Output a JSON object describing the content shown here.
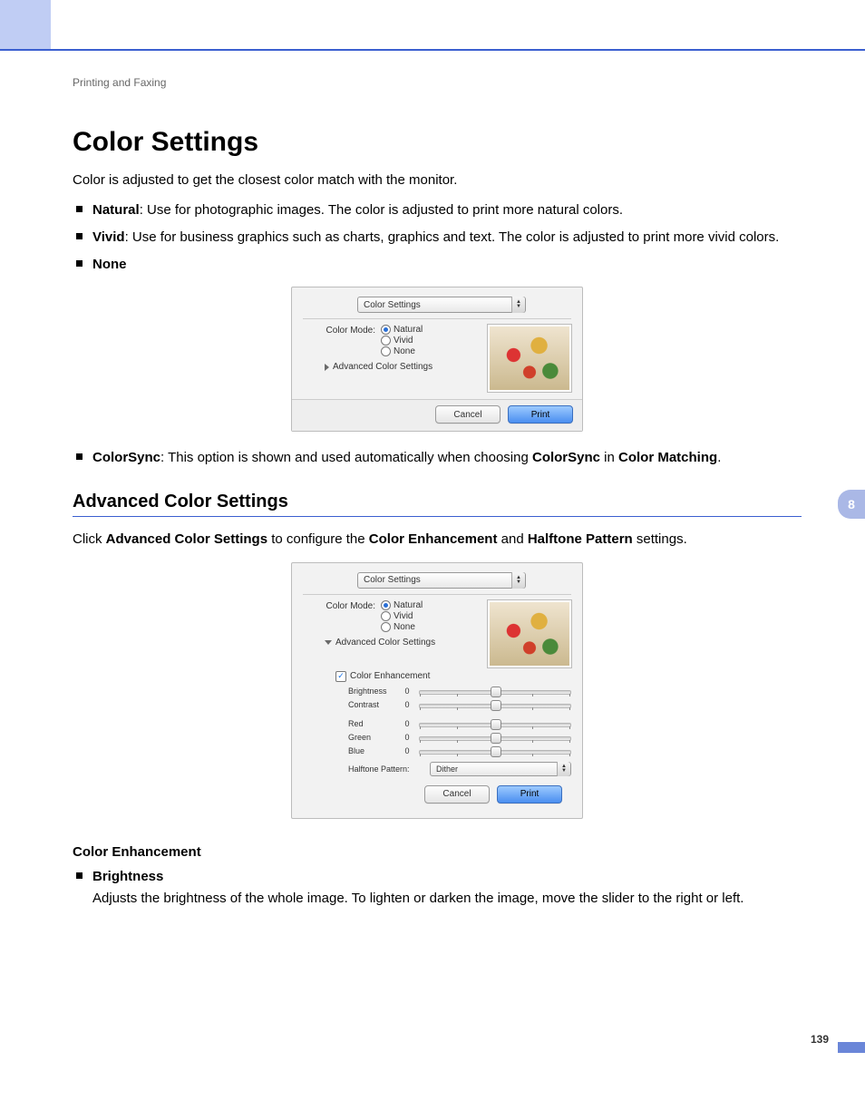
{
  "header": {
    "section": "Printing and Faxing"
  },
  "chapter_tab": "8",
  "page_number": "139",
  "title": "Color Settings",
  "intro": "Color is adjusted to get the closest color match with the monitor.",
  "mode_list": {
    "natural": {
      "label": "Natural",
      "desc": ": Use for photographic images. The color is adjusted to print more natural colors."
    },
    "vivid": {
      "label": "Vivid",
      "desc": ": Use for business graphics such as charts, graphics and text. The color is adjusted to print more vivid colors."
    },
    "none": {
      "label": "None"
    }
  },
  "dialog": {
    "dropdown": "Color Settings",
    "color_mode_label": "Color Mode:",
    "radios": {
      "natural": "Natural",
      "vivid": "Vivid",
      "none": "None"
    },
    "disclosure": "Advanced Color Settings",
    "cancel": "Cancel",
    "print": "Print"
  },
  "colorsync": {
    "label": "ColorSync",
    "text1": ": This option is shown and used automatically when choosing ",
    "cs2": "ColorSync",
    "text2": " in ",
    "cm": "Color Matching",
    "text3": "."
  },
  "adv": {
    "title": "Advanced Color Settings",
    "lead1": "Click ",
    "lead_bold1": "Advanced Color Settings",
    "lead2": " to configure the ",
    "lead_bold2": "Color Enhancement",
    "lead3": " and ",
    "lead_bold3": "Halftone Pattern",
    "lead4": " settings."
  },
  "dialog2": {
    "color_enh": "Color Enhancement",
    "sliders": {
      "brightness": {
        "label": "Brightness",
        "val": "0"
      },
      "contrast": {
        "label": "Contrast",
        "val": "0"
      },
      "red": {
        "label": "Red",
        "val": "0"
      },
      "green": {
        "label": "Green",
        "val": "0"
      },
      "blue": {
        "label": "Blue",
        "val": "0"
      }
    },
    "halftone_label": "Halftone Pattern:",
    "halftone_value": "Dither"
  },
  "enhancement": {
    "heading": "Color Enhancement",
    "brightness": {
      "label": "Brightness",
      "desc": "Adjusts the brightness of the whole image. To lighten or darken the image, move the slider to the right or left."
    }
  }
}
